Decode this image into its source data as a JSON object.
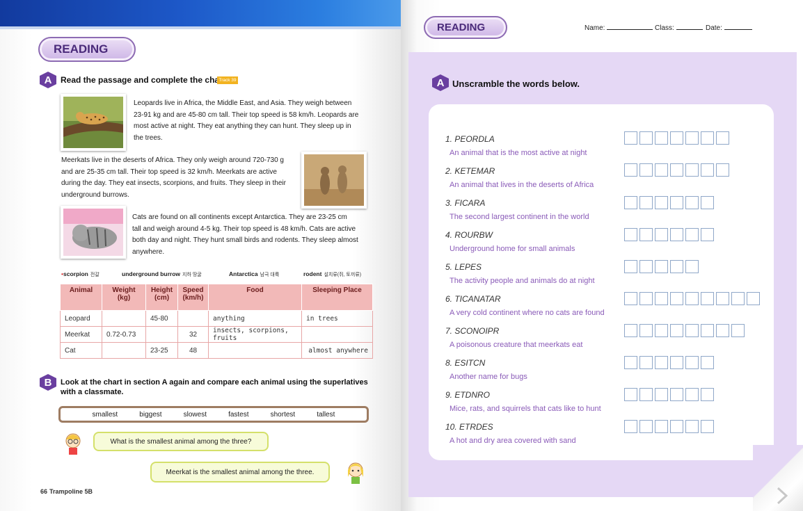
{
  "left_page": {
    "reading_label": "READING",
    "section_a": {
      "letter": "A",
      "title": "Read the passage and complete the chart.",
      "track": "Track 39"
    },
    "paragraphs": [
      [
        "Leopards live in Africa, the Middle East, and Asia. They weigh between",
        "23-91 kg and are 45-80 cm tall. Their top speed is 58 km/h. Leopards are",
        "most active at night. They eat anything they can hunt. They sleep up in",
        "the trees."
      ],
      [
        "Meerkats live in the deserts of Africa. They only weigh around 720-730 g",
        "and are 25-35 cm tall. Their top speed is 32 km/h. Meerkats are active",
        "during the day. They eat insects, scorpions, and fruits. They sleep in their",
        "underground burrows."
      ],
      [
        "Cats are found on all continents except Antarctica. They are 23-25 cm",
        "tall and weigh around 4-5 kg. Their top speed is 48 km/h. Cats are active",
        "both day and night. They hunt small birds and rodents. They sleep almost",
        "anywhere."
      ]
    ],
    "glossary": [
      {
        "word": "scorpion",
        "meaning": "전갈"
      },
      {
        "word": "underground burrow",
        "meaning": "지하 땅굴"
      },
      {
        "word": "Antarctica",
        "meaning": "남극 대륙"
      },
      {
        "word": "rodent",
        "meaning": "설치류(쥐, 토끼류)"
      }
    ],
    "chart": {
      "headers": [
        [
          "Animal"
        ],
        [
          "Weight",
          "(kg)"
        ],
        [
          "Height",
          "(cm)"
        ],
        [
          "Speed",
          "(km/h)"
        ],
        [
          "Food"
        ],
        [
          "Sleeping Place"
        ]
      ],
      "rows": [
        [
          "Leopard",
          "",
          "45-80",
          "",
          "anything",
          "in trees"
        ],
        [
          "Meerkat",
          "0.72-0.73",
          "",
          "32",
          "insects, scorpions, fruits",
          ""
        ],
        [
          "Cat",
          "",
          "23-25",
          "48",
          "",
          "almost anywhere"
        ]
      ]
    },
    "section_b": {
      "letter": "B",
      "title_line1": "Look at the chart in section A again and compare each animal using the superlatives",
      "title_line2": "with a classmate."
    },
    "words": [
      "smallest",
      "biggest",
      "slowest",
      "fastest",
      "shortest",
      "tallest"
    ],
    "question": "What is the smallest animal among the three?",
    "answer": "Meerkat is the smallest animal among the three.",
    "page_number": "66",
    "book": "Trampoline 5B"
  },
  "right_page": {
    "reading_label": "READING",
    "name_label": "Name:",
    "class_label": "Class:",
    "date_label": "Date:",
    "section_a": {
      "letter": "A",
      "title": "Unscramble the words below."
    },
    "items": [
      {
        "scrambled": "1. PEORDLA",
        "hint": "An animal that is the most active at night",
        "boxes": 7
      },
      {
        "scrambled": "2. KETEMAR",
        "hint": "An animal that lives in the deserts of Africa",
        "boxes": 7
      },
      {
        "scrambled": "3. FICARA",
        "hint": "The second largest continent in the world",
        "boxes": 6
      },
      {
        "scrambled": "4. ROURBW",
        "hint": "Underground home for small animals",
        "boxes": 6
      },
      {
        "scrambled": "5. LEPES",
        "hint": "The activity people and animals do at night",
        "boxes": 5
      },
      {
        "scrambled": "6. TICANATAR",
        "hint": "A very cold continent where no cats are found",
        "boxes": 9
      },
      {
        "scrambled": "7. SCONOIPR",
        "hint": "A poisonous creature that meerkats eat",
        "boxes": 8
      },
      {
        "scrambled": "8. ESITCN",
        "hint": "Another name for bugs",
        "boxes": 6
      },
      {
        "scrambled": "9. ETDNRO",
        "hint": "Mice, rats, and squirrels that cats like to hunt",
        "boxes": 6
      },
      {
        "scrambled": "10. ETRDES",
        "hint": "A hot and dry area covered with sand",
        "boxes": 6
      }
    ]
  }
}
